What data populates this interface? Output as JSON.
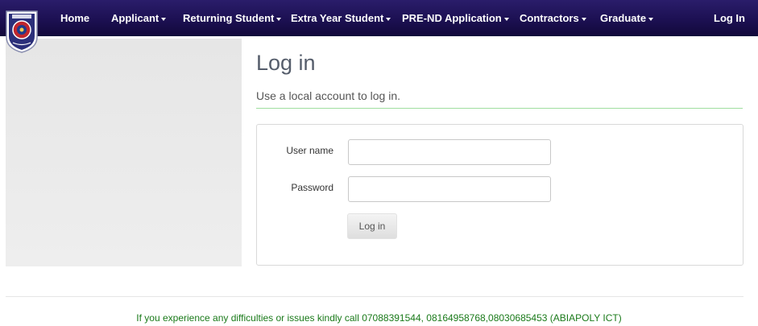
{
  "nav": {
    "home": "Home",
    "applicant": "Applicant",
    "returning_student": "Returning Student",
    "extra_year_student": "Extra Year Student",
    "pre_nd_application": "PRE-ND Application",
    "contractors": "Contractors",
    "graduate": "Graduate",
    "login": "Log In"
  },
  "main": {
    "title": "Log in",
    "subtitle": "Use a local account to log in."
  },
  "form": {
    "username_label": "User name",
    "username_value": "",
    "password_label": "Password",
    "password_value": "",
    "submit_label": "Log in"
  },
  "footer": {
    "text": "If you experience any difficulties or issues kindly call 07088391544, 08164958768,08030685453 (ABIAPOLY ICT)"
  },
  "colors": {
    "navbar": "#1c1052",
    "accent_rule": "#9fde9f",
    "footer_text": "#1a7a1a"
  },
  "icons": {
    "logo": "institution-crest-icon",
    "dropdown": "caret-down-icon"
  }
}
